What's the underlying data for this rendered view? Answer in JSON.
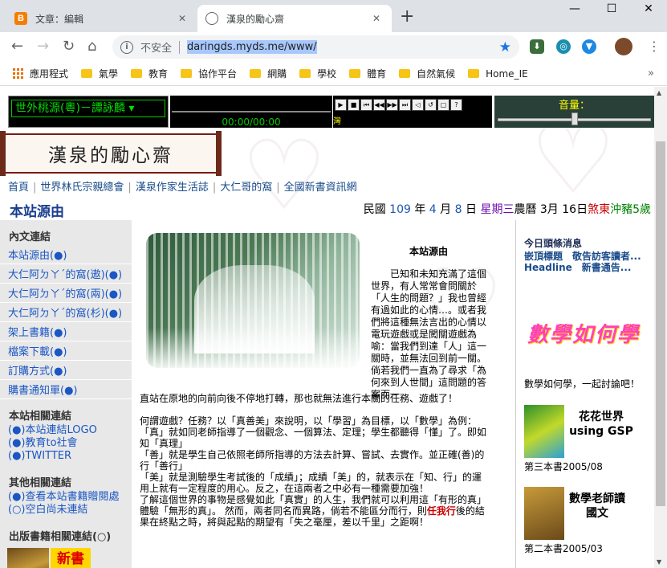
{
  "browser": {
    "tabs": [
      {
        "title": "文章：編輯",
        "icon": "blogger-icon",
        "active": false
      },
      {
        "title": "漢泉的勵心齋",
        "icon": "globe-icon",
        "active": true
      }
    ],
    "address": {
      "security_label": "不安全",
      "url": "daringds.myds.me/www/"
    },
    "bookmarks": [
      {
        "label": "應用程式",
        "icon": "apps-icon"
      },
      {
        "label": "氣學"
      },
      {
        "label": "教育"
      },
      {
        "label": "協作平台"
      },
      {
        "label": "網購"
      },
      {
        "label": "學校"
      },
      {
        "label": "體育"
      },
      {
        "label": "自然氣候"
      },
      {
        "label": "Home_IE"
      }
    ]
  },
  "player": {
    "title": "世外桃源(粵)－譚詠麟",
    "time": "00:00/00:00",
    "volume_label": "音量：",
    "volume_level": 0.5,
    "controls": [
      "play",
      "stop",
      "prev",
      "rewind",
      "forward",
      "next",
      "mute",
      "repeat",
      "shuffle",
      "help"
    ],
    "status_char": "灣"
  },
  "site": {
    "logo_text": "漢泉的勵心齋",
    "nav": [
      "首頁",
      "世界林氏宗親總會",
      "漢泉作家生活誌",
      "大仁哥的窩",
      "全國新書資訊網"
    ],
    "heading": "本站源由",
    "date": {
      "prefix": "民國",
      "year": "109",
      "year_unit": "年",
      "month": "4",
      "month_unit": "月",
      "day": "8",
      "day_unit": "日",
      "weekday": "星期三",
      "lunar": "農曆 3月 16日",
      "sha": "煞東",
      "chong": "沖豬5歲"
    }
  },
  "sidebar": {
    "sections": [
      {
        "title": "內文連結",
        "links": [
          "本站源由(●)",
          "大仁阿ㄉㄚˊ的窩(遨)(●)",
          "大仁阿ㄉㄚˊ的窩(兩)(●)",
          "大仁阿ㄉㄚˊ的窩(杉)(●)",
          "架上書籍(●)",
          "檔案下載(●)",
          "訂購方式(●)",
          "購書通知單(●)"
        ]
      },
      {
        "title": "本站相關連結",
        "links": [
          "(●)本站連結LOGO",
          "(●)教育to社會",
          "(●)TWITTER"
        ]
      },
      {
        "title": "其他相關連結",
        "links": [
          "(●)查看本站書籍贈閱處",
          "(○)空白尚未連結"
        ]
      },
      {
        "title": "出版書籍相關連結(○)",
        "links": []
      }
    ],
    "book_badge": "新書"
  },
  "article": {
    "title": "本站源由",
    "intro": "已知和未知充滿了這個世界，有人常常會問關於「人生的問題？」我也曾經有過如此的心情…。或者我們將這種無法言出的心情以電玩遊戲或是闖關遊戲為喻：當我們到達「人」這一關時，並無法回到前一關。倘若我們一直為了尋求「為何來到人世間」這問題的答案而一",
    "continuation": "直站在原地的向前向後不停地打轉，那也就無法進行本關的任務、遊戲了！",
    "body": [
      "何謂遊戲？任務？以「真善美」來說明，以「學習」為目標，以「數學」為例：",
      "「真」就如同老師指導了一個觀念、一個算法、定理；學生都聽得「懂」了。即如知「真理」",
      "「善」就是學生自己依照老師所指導的方法去計算、嘗試、去實作。並正確(善)的行「善行」",
      "「美」就是測驗學生考試後的「成績」；成績「美」的，就表示在「知、行」的運用上就有一定程度的用心。反之，在這兩者之中必有一種需要加強！",
      "了解這個世界的事物是感覺如此「真實」的人生，我們就可以利用這「有形的真」體驗「無形的真」。 然而，兩者同名而異路，倘若不能區分而行，則"
    ],
    "emphasis": "任我行",
    "ending": "後的結果在終點之時，將與起點的期望有「失之毫厘，差以千里」之距啊！"
  },
  "rightcol": {
    "headline_title": "今日頭條消息",
    "marquee": "嵌頂標題　敬告訪客讀者...　Headline　新書通告...",
    "fancy_text": "數學如何學",
    "caption": "數學如何學，一起討論吧！",
    "books": [
      {
        "label": "花花世界 using GSP",
        "caption": "第三本書2005/08"
      },
      {
        "label": "數學老師讀國文",
        "caption": "第二本書2005/03"
      }
    ]
  }
}
